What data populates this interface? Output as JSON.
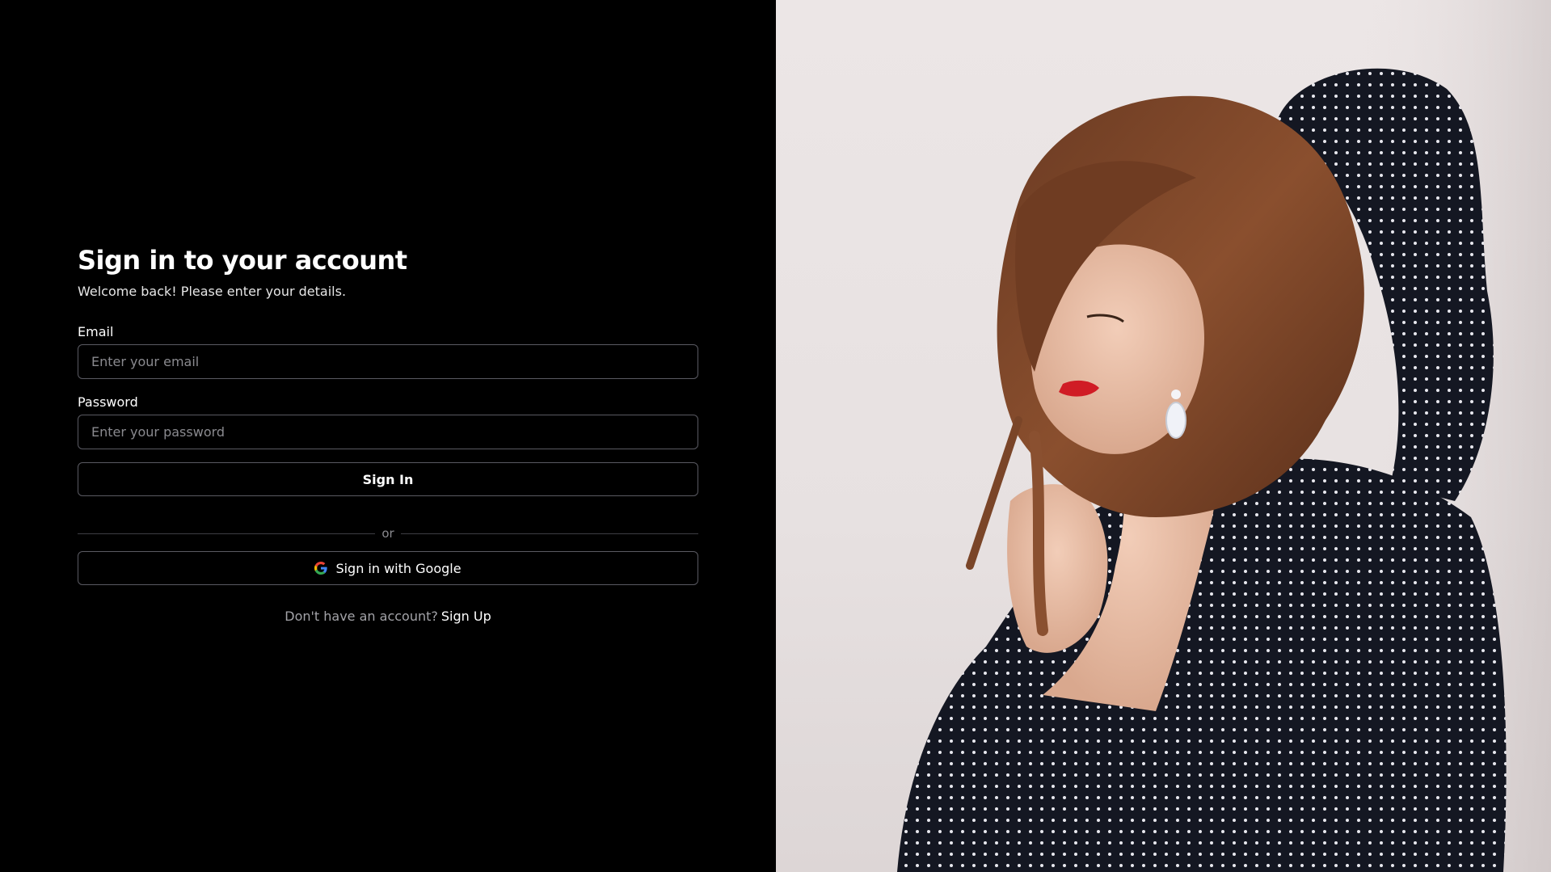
{
  "login": {
    "title": "Sign in to your account",
    "subtitle": "Welcome back! Please enter your details.",
    "email_label": "Email",
    "email_placeholder": "Enter your email",
    "email_value": "",
    "password_label": "Password",
    "password_placeholder": "Enter your password",
    "password_value": "",
    "sign_in_label": "Sign In",
    "divider_text": "or",
    "google_label": "Sign in with Google",
    "signup_prompt": "Don't have an account?",
    "signup_link": "Sign Up"
  },
  "icons": {
    "google": "google-icon"
  },
  "colors": {
    "background": "#000000",
    "text": "#ffffff",
    "muted_text": "#8a8a8f",
    "border": "#5a5a62",
    "google_blue": "#4285F4",
    "google_red": "#EA4335",
    "google_yellow": "#FBBC05",
    "google_green": "#34A853"
  }
}
